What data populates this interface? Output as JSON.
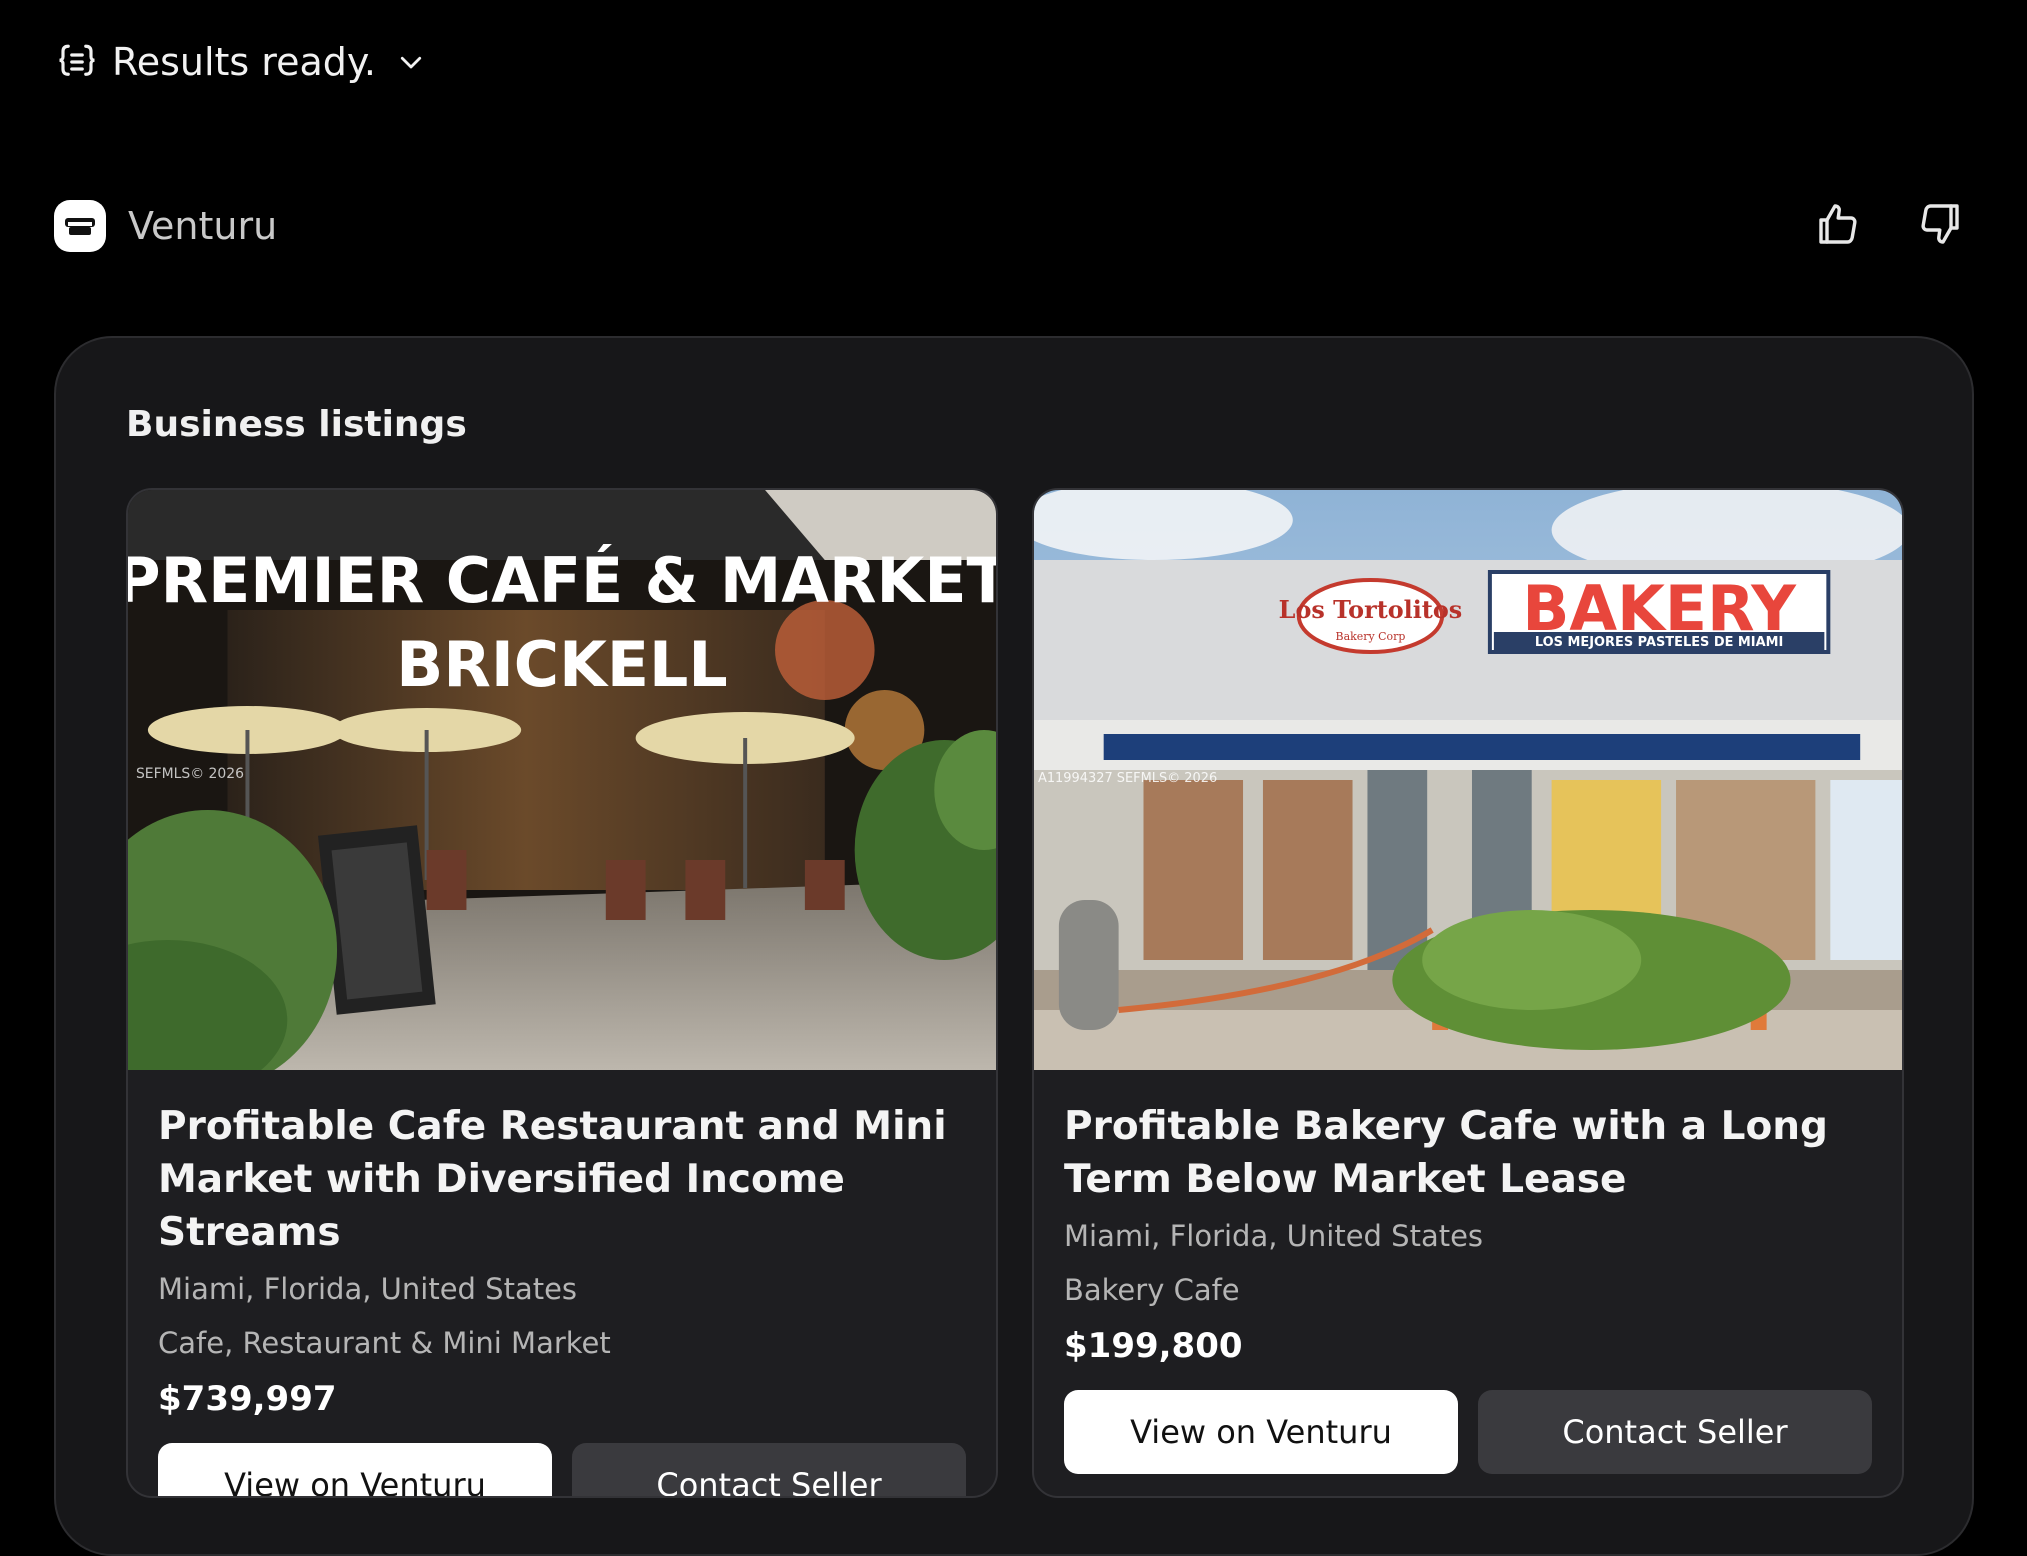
{
  "status": {
    "text": "Results ready.",
    "icon": "braces-list-icon",
    "chevron": "chevron-down-icon"
  },
  "agent": {
    "name": "Venturu",
    "logo": "venturu-logo"
  },
  "feedback": {
    "up": "thumbs-up-icon",
    "down": "thumbs-down-icon"
  },
  "panel": {
    "title": "Business listings"
  },
  "listings": [
    {
      "image_overlay_line1": "PREMIER CAFÉ & MARKET",
      "image_overlay_line2": "BRICKELL",
      "image_watermark": "SEFMLS© 2026",
      "title": "Profitable Cafe Restaurant and Mini Market with Diversified Income Streams",
      "location": "Miami, Florida, United States",
      "category": "Cafe, Restaurant & Mini Market",
      "price": "$739,997",
      "primary_button": "View on Venturu",
      "secondary_button": "Contact Seller"
    },
    {
      "image_sign_logo": "Los Tortolitos",
      "image_sign_logo_sub": "Bakery Corp",
      "image_sign_main": "BAKERY",
      "image_sign_sub": "LOS MEJORES PASTELES DE MIAMI",
      "image_watermark": "A11994327 SEFMLS© 2026",
      "title": "Profitable Bakery Cafe with a Long Term Below Market Lease",
      "location": "Miami, Florida, United States",
      "category": "Bakery Cafe",
      "price": "$199,800",
      "primary_button": "View on Venturu",
      "secondary_button": "Contact Seller"
    }
  ],
  "colors": {
    "page_bg": "#000000",
    "panel_bg": "#171719",
    "card_bg": "#1e1e21",
    "secondary_btn": "#3a3a3e",
    "bakery_red": "#e8463c"
  }
}
